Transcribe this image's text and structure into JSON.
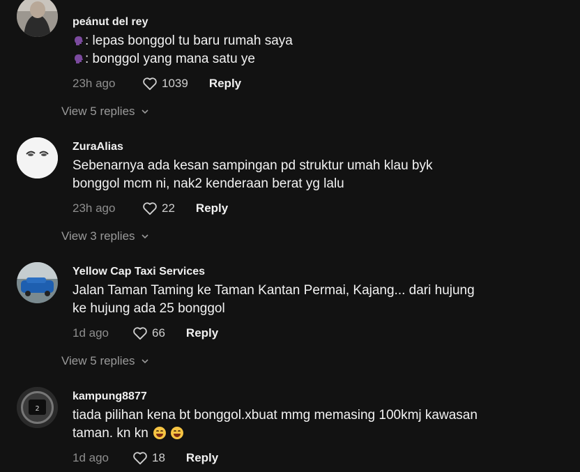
{
  "comments": [
    {
      "username": "peánut del rey",
      "lines": [
        ": lepas bonggol tu baru rumah saya",
        ": bonggol yang mana satu ye"
      ],
      "time": "23h ago",
      "likes": "1039",
      "reply_label": "Reply",
      "view_replies": "View 5 replies"
    },
    {
      "username": "ZuraAlias",
      "lines": [
        "Sebenarnya ada kesan sampingan pd struktur umah klau byk",
        "bonggol mcm ni, nak2 kenderaan berat yg lalu"
      ],
      "time": "23h ago",
      "likes": "22",
      "reply_label": "Reply",
      "view_replies": "View 3 replies"
    },
    {
      "username": "Yellow Cap Taxi Services",
      "lines": [
        "Jalan Taman Taming ke Taman Kantan Permai, Kajang... dari hujung",
        "ke hujung ada 25 bonggol"
      ],
      "time": "1d ago",
      "likes": "66",
      "reply_label": "Reply",
      "view_replies": "View 5 replies"
    },
    {
      "username": "kampung8877",
      "lines": [
        "tiada pilihan kena bt bonggol.xbuat mmg memasing 100kmj kawasan",
        "taman. kn kn "
      ],
      "time": "1d ago",
      "likes": "18",
      "reply_label": "Reply"
    }
  ],
  "icons": {
    "speaking_head": "speaking-head-icon",
    "heart": "heart-icon",
    "chevron": "chevron-down-icon",
    "emoji": "rolling-laughing-emoji-icon"
  },
  "colors": {
    "background": "#121212",
    "muted": "#8e8e8e",
    "text": "#f2f2f2"
  }
}
